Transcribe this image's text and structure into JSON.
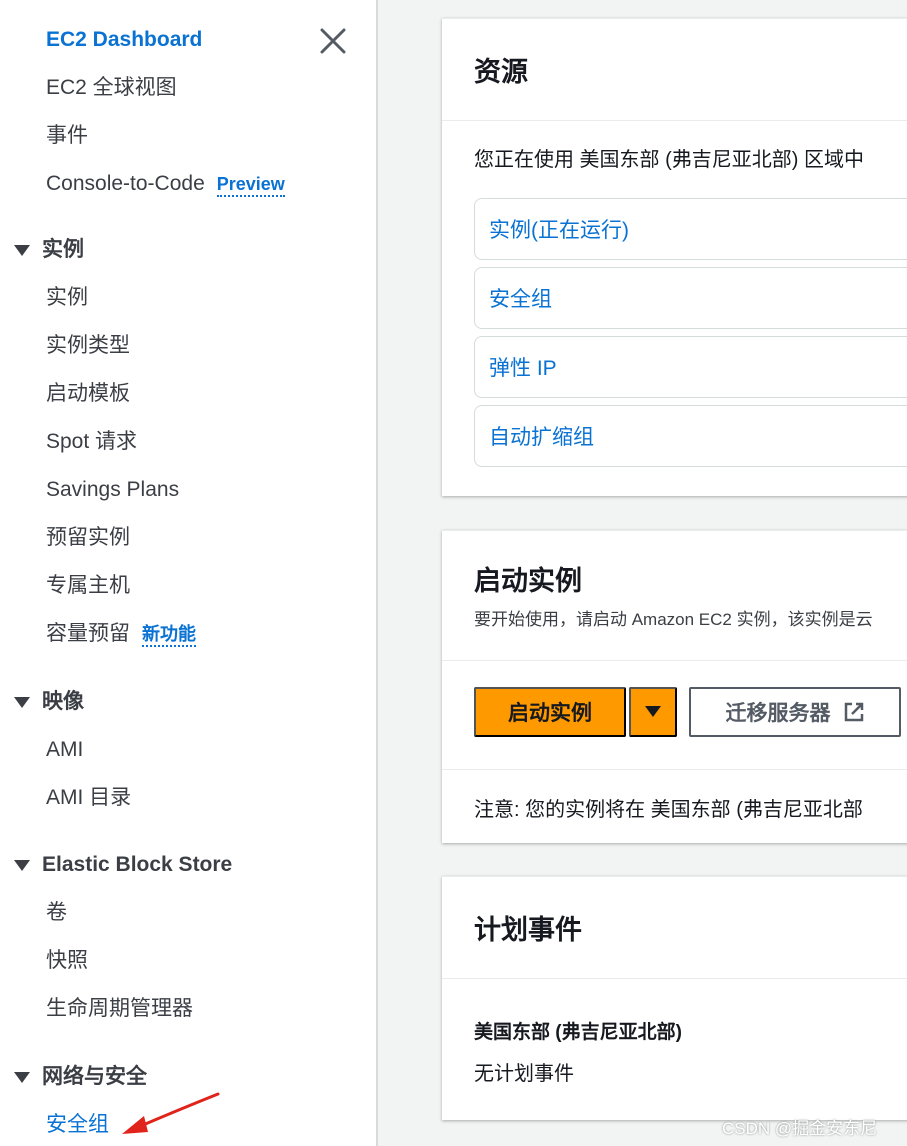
{
  "sidebar": {
    "dashboard": "EC2 Dashboard",
    "global_view": "EC2 全球视图",
    "events": "事件",
    "console_to_code": "Console-to-Code",
    "preview_badge": "Preview",
    "sections": {
      "instances": "实例",
      "images": "映像",
      "ebs": "Elastic Block Store",
      "network": "网络与安全"
    },
    "instances_items": [
      "实例",
      "实例类型",
      "启动模板",
      "Spot 请求",
      "Savings Plans",
      "预留实例",
      "专属主机",
      "容量预留"
    ],
    "new_badge": "新功能",
    "images_items": [
      "AMI",
      "AMI 目录"
    ],
    "ebs_items": [
      "卷",
      "快照",
      "生命周期管理器"
    ],
    "network_items": [
      "安全组"
    ]
  },
  "resources": {
    "title": "资源",
    "region_text": "您正在使用 美国东部 (弗吉尼亚北部) 区域中",
    "links": [
      "实例(正在运行)",
      "安全组",
      "弹性 IP",
      "自动扩缩组"
    ]
  },
  "launch": {
    "title": "启动实例",
    "description": "要开始使用，请启动 Amazon EC2 实例，该实例是云",
    "launch_button": "启动实例",
    "migrate_button": "迁移服务器",
    "note": "注意: 您的实例将在 美国东部 (弗吉尼亚北部"
  },
  "scheduled": {
    "title": "计划事件",
    "region": "美国东部 (弗吉尼亚北部)",
    "empty_text": "无计划事件"
  },
  "watermark": "CSDN @掘金安东尼",
  "colors": {
    "link": "#0972d3",
    "primary_button": "#ff9900",
    "annotation_arrow": "#e0231b"
  }
}
